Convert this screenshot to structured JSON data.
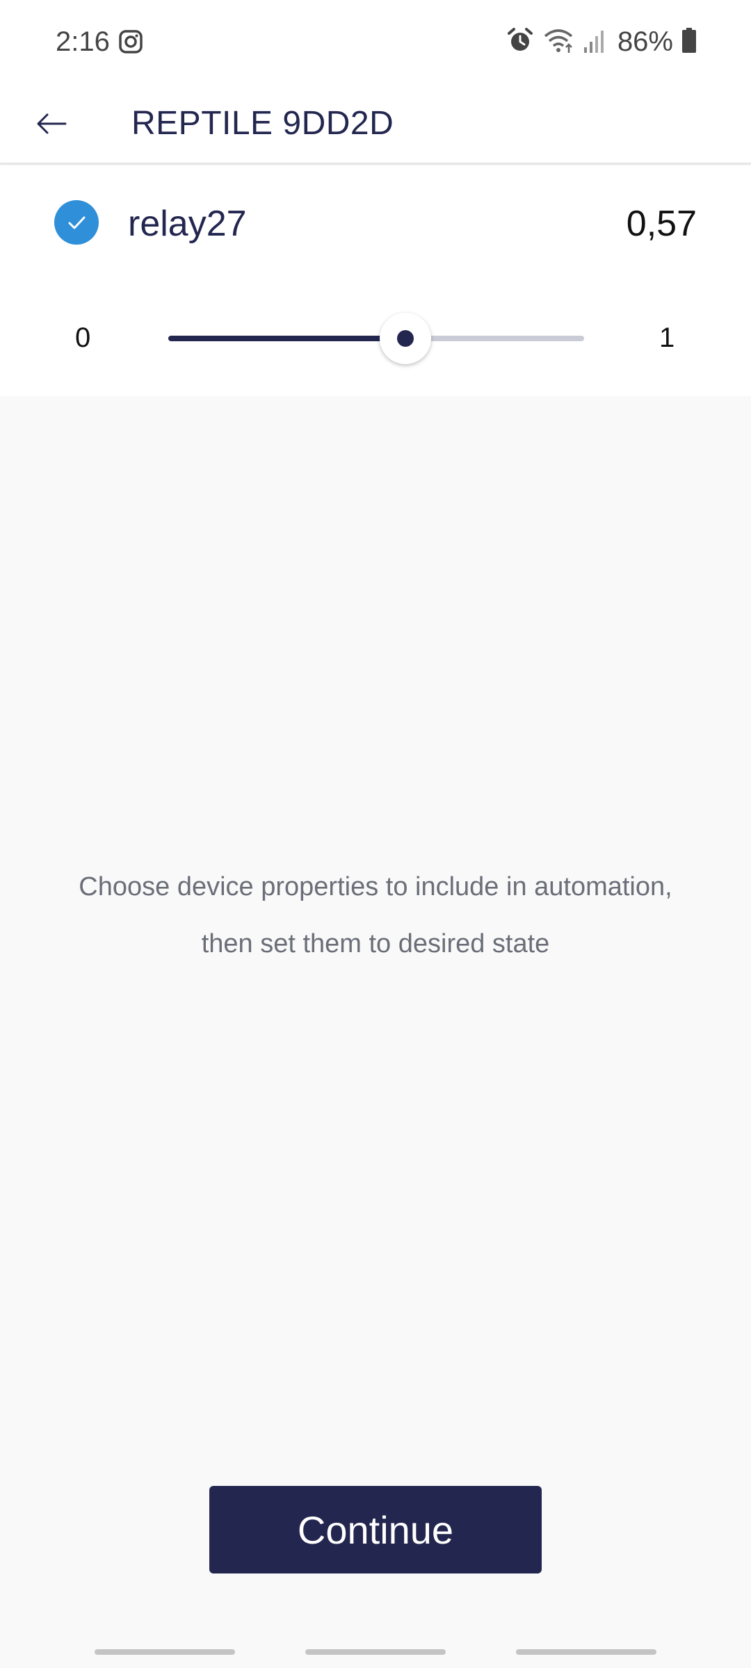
{
  "status_bar": {
    "time": "2:16",
    "battery": "86%",
    "icons": [
      "instagram-icon",
      "alarm-icon",
      "wifi-icon",
      "signal-icon",
      "battery-icon"
    ]
  },
  "app_bar": {
    "title": "REPTILE 9DD2D",
    "back_icon": "arrow-left-icon"
  },
  "property": {
    "checked": true,
    "name": "relay27",
    "value": "0,57",
    "slider": {
      "min_label": "0",
      "max_label": "1",
      "min": 0,
      "max": 1,
      "value": 0.57
    }
  },
  "hint": {
    "line1": "Choose device properties to include in automation,",
    "line2": "then set them to desired state"
  },
  "actions": {
    "continue_label": "Continue"
  },
  "colors": {
    "primary": "#23264f",
    "checkbox": "#2f8fd8",
    "track": "#c9ccd6",
    "background": "#f9f9f9"
  }
}
